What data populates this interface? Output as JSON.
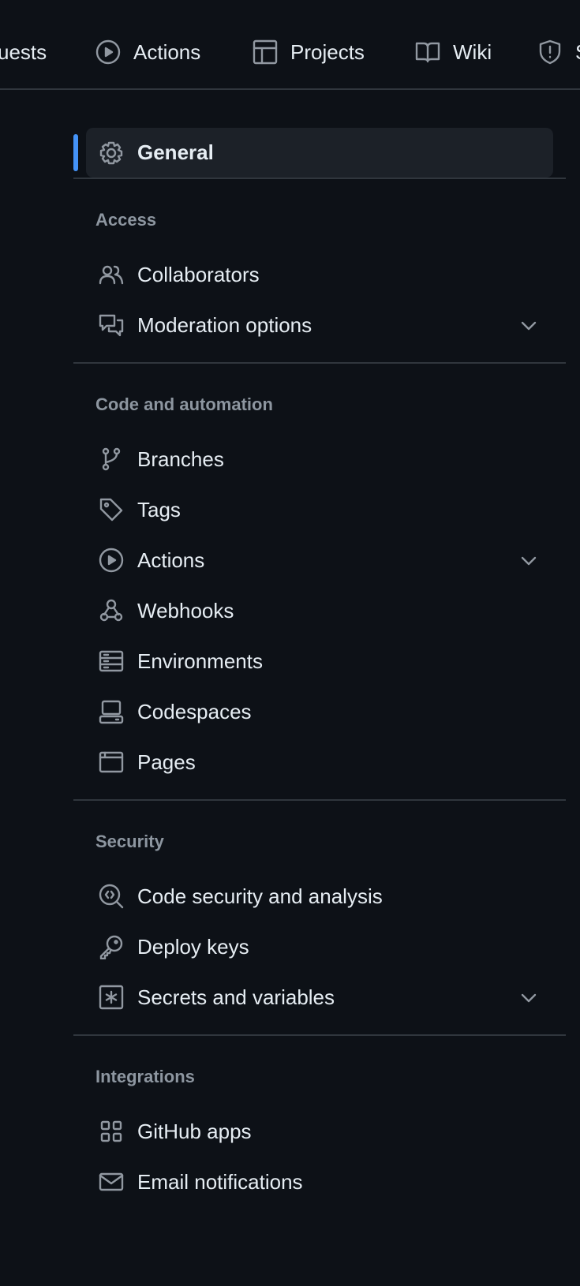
{
  "topnav": {
    "items": [
      {
        "label": "uests",
        "icon": "pull-request-icon"
      },
      {
        "label": "Actions",
        "icon": "play-icon"
      },
      {
        "label": "Projects",
        "icon": "table-icon"
      },
      {
        "label": "Wiki",
        "icon": "book-icon"
      },
      {
        "label": "S",
        "icon": "shield-icon"
      }
    ]
  },
  "sidebar": {
    "general": {
      "label": "General",
      "icon": "gear-icon",
      "selected": true
    },
    "sections": [
      {
        "heading": "Access",
        "items": [
          {
            "label": "Collaborators",
            "icon": "people-icon"
          },
          {
            "label": "Moderation options",
            "icon": "comment-discussion-icon",
            "expandable": true
          }
        ]
      },
      {
        "heading": "Code and automation",
        "items": [
          {
            "label": "Branches",
            "icon": "git-branch-icon"
          },
          {
            "label": "Tags",
            "icon": "tag-icon"
          },
          {
            "label": "Actions",
            "icon": "play-icon",
            "expandable": true
          },
          {
            "label": "Webhooks",
            "icon": "webhook-icon"
          },
          {
            "label": "Environments",
            "icon": "server-icon"
          },
          {
            "label": "Codespaces",
            "icon": "codespaces-icon"
          },
          {
            "label": "Pages",
            "icon": "browser-icon"
          }
        ]
      },
      {
        "heading": "Security",
        "items": [
          {
            "label": "Code security and analysis",
            "icon": "codescan-icon"
          },
          {
            "label": "Deploy keys",
            "icon": "key-icon"
          },
          {
            "label": "Secrets and variables",
            "icon": "key-asterisk-icon",
            "expandable": true
          }
        ]
      },
      {
        "heading": "Integrations",
        "items": [
          {
            "label": "GitHub apps",
            "icon": "apps-icon"
          },
          {
            "label": "Email notifications",
            "icon": "mail-icon"
          }
        ]
      }
    ]
  },
  "colors": {
    "background": "#0d1117",
    "accent": "#4493f8",
    "selected_bg": "#1c2128",
    "text": "#e6edf3",
    "muted": "#8d96a0",
    "divider": "#30363d"
  }
}
